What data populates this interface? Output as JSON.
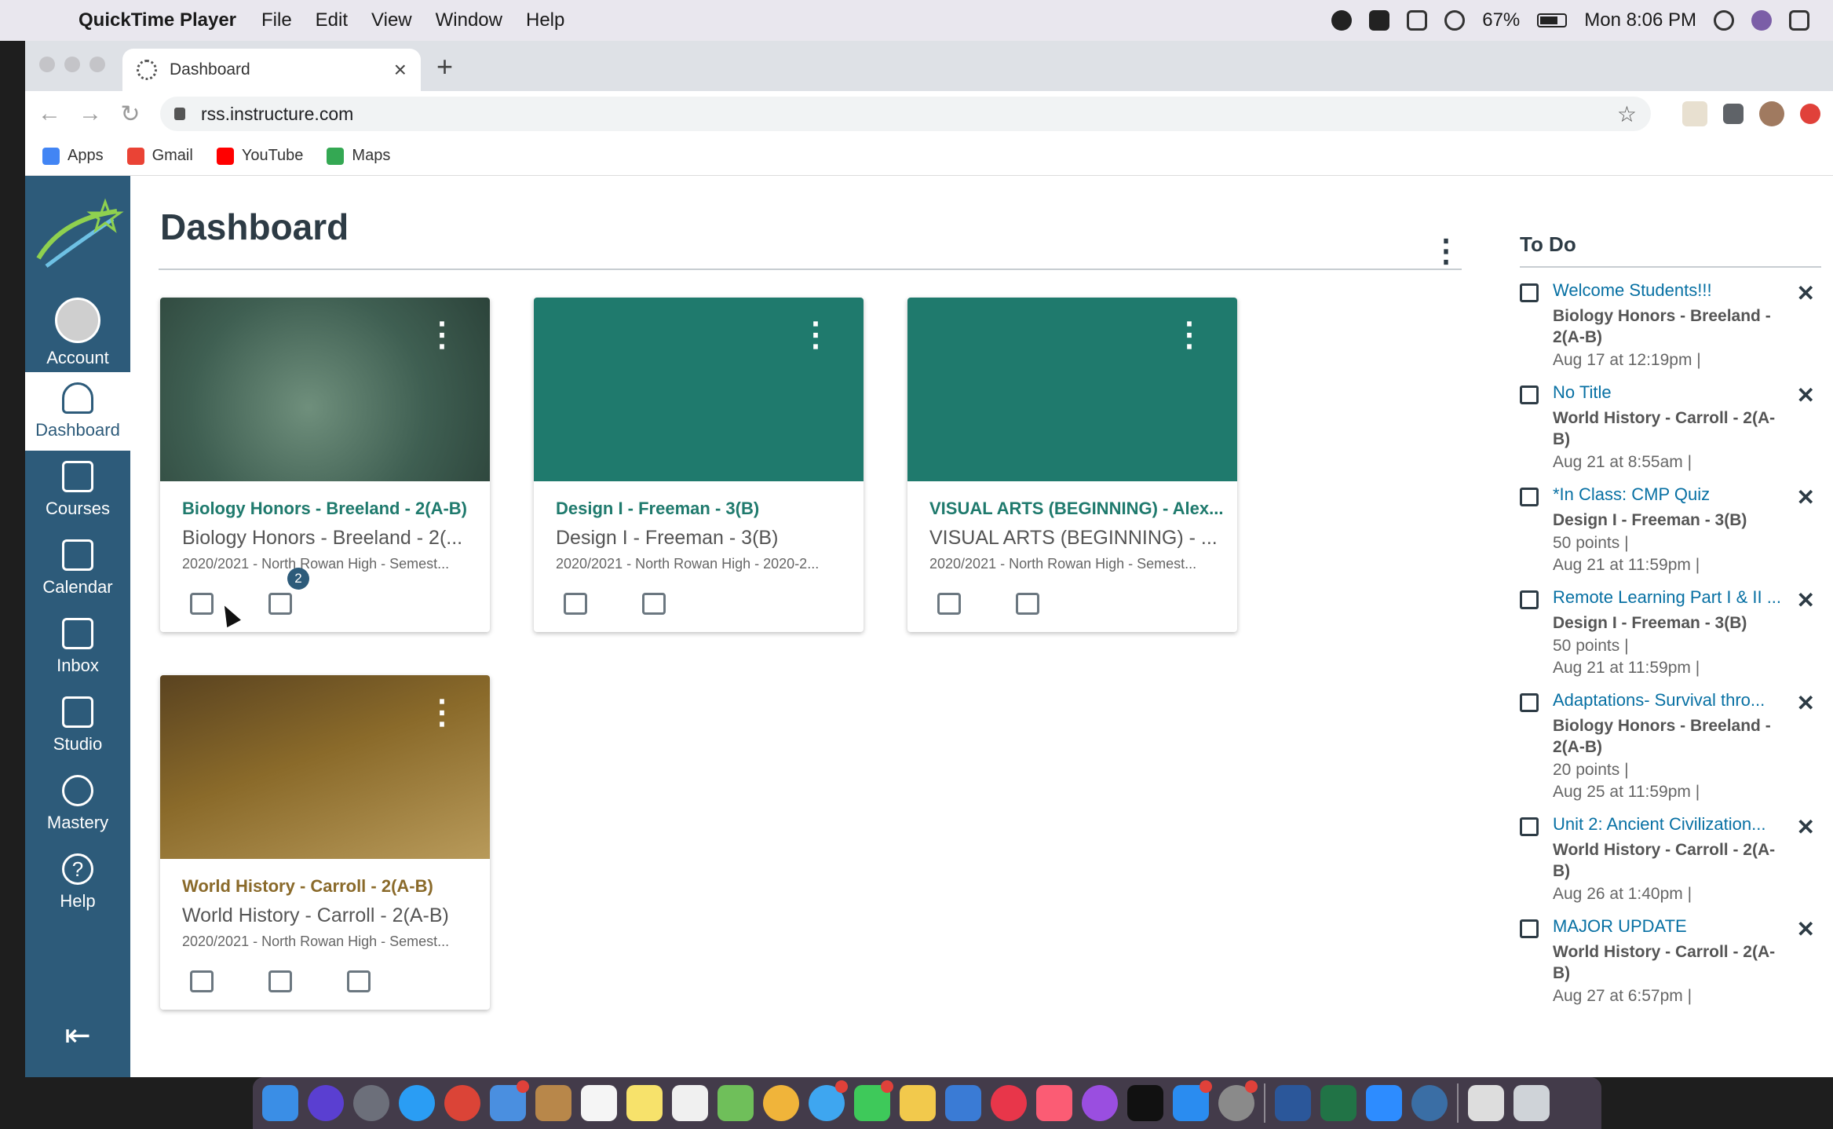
{
  "menubar": {
    "app_name": "QuickTime Player",
    "menus": [
      "File",
      "Edit",
      "View",
      "Window",
      "Help"
    ],
    "battery": "67%",
    "clock": "Mon 8:06 PM"
  },
  "browser": {
    "tab_title": "Dashboard",
    "url": "rss.instructure.com",
    "bookmarks": [
      "Apps",
      "Gmail",
      "YouTube",
      "Maps"
    ]
  },
  "nav": {
    "items": [
      "Account",
      "Dashboard",
      "Courses",
      "Calendar",
      "Inbox",
      "Studio",
      "Mastery",
      "Help"
    ]
  },
  "dashboard": {
    "title": "Dashboard",
    "cards": [
      {
        "title": "Biology Honors - Breeland - 2(A-B)",
        "subtitle": "Biology Honors - Breeland - 2(...",
        "term": "2020/2021 - North Rowan High - Semest...",
        "color": "#1f7a6d",
        "title_color": "#1f7a6d",
        "badge": "2"
      },
      {
        "title": "Design I - Freeman - 3(B)",
        "subtitle": "Design I - Freeman - 3(B)",
        "term": "2020/2021 - North Rowan High - 2020-2...",
        "color": "#1f7a6d",
        "title_color": "#1f7a6d"
      },
      {
        "title": "VISUAL ARTS (BEGINNING) - Alex...",
        "subtitle": "VISUAL ARTS (BEGINNING) - ...",
        "term": "2020/2021 - North Rowan High - Semest...",
        "color": "#1f7a6d",
        "title_color": "#1f7a6d"
      },
      {
        "title": "World History - Carroll - 2(A-B)",
        "subtitle": "World History - Carroll - 2(A-B)",
        "term": "2020/2021 - North Rowan High - Semest...",
        "color": "#8a6a2a",
        "title_color": "#8a6a2a"
      }
    ]
  },
  "todo": {
    "heading": "To Do",
    "items": [
      {
        "title": "Welcome Students!!!",
        "course": "Biology Honors - Breeland - 2(A-B)",
        "points": "",
        "date": "Aug 17 at 12:19pm  |"
      },
      {
        "title": "No Title",
        "course": "World History - Carroll - 2(A-B)",
        "points": "",
        "date": "Aug 21 at 8:55am  |"
      },
      {
        "title": "*In Class: CMP Quiz",
        "course": "Design I - Freeman - 3(B)",
        "points": "50 points  |",
        "date": "Aug 21 at 11:59pm  |"
      },
      {
        "title": "Remote Learning Part I & II ...",
        "course": "Design I - Freeman - 3(B)",
        "points": "50 points  |",
        "date": "Aug 21 at 11:59pm  |"
      },
      {
        "title": "Adaptations- Survival thro...",
        "course": "Biology Honors - Breeland - 2(A-B)",
        "points": "20 points  |",
        "date": "Aug 25 at 11:59pm  |"
      },
      {
        "title": "Unit 2: Ancient Civilization...",
        "course": "World History - Carroll - 2(A-B)",
        "points": "",
        "date": "Aug 26 at 1:40pm  |"
      },
      {
        "title": "MAJOR UPDATE",
        "course": "World History - Carroll - 2(A-B)",
        "points": "",
        "date": "Aug 27 at 6:57pm  |"
      }
    ]
  }
}
